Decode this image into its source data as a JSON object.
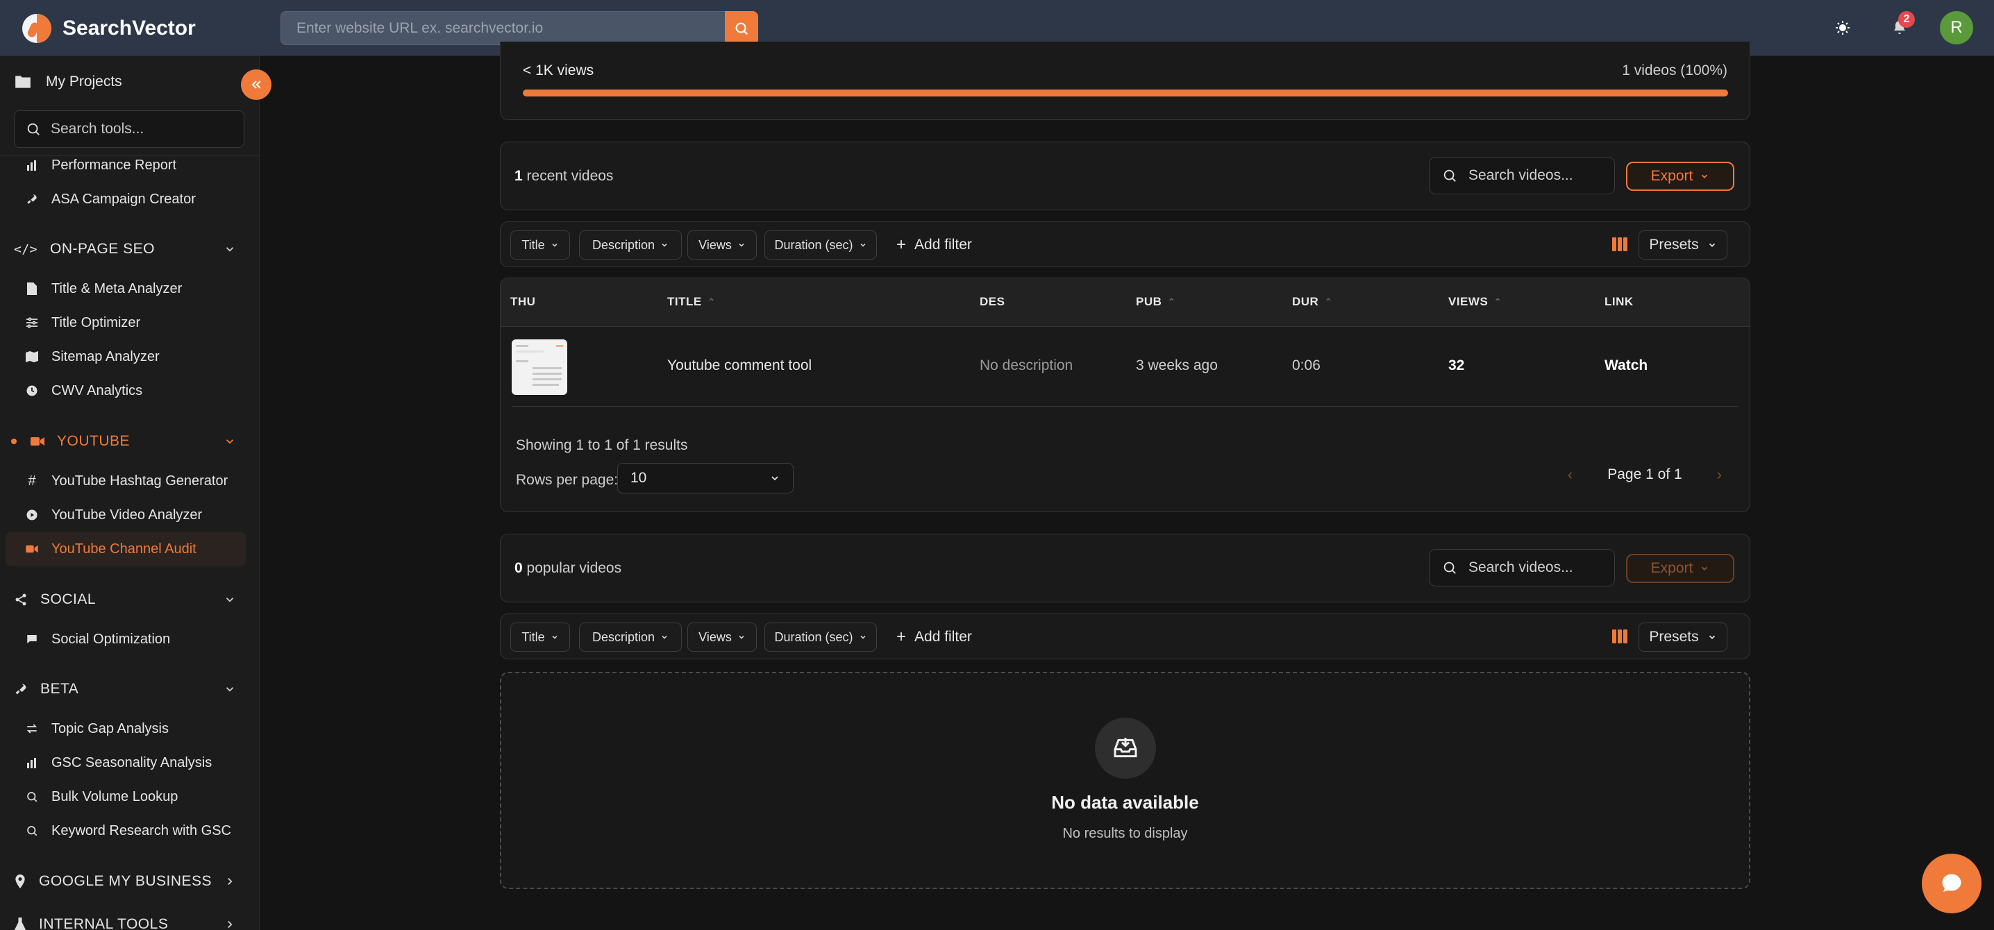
{
  "app": {
    "name": "SearchVector"
  },
  "topbar": {
    "url_placeholder": "Enter website URL ex. searchvector.io",
    "notification_count": "2",
    "avatar_initial": "R"
  },
  "sidebar": {
    "project_label": "My Projects",
    "search_placeholder": "Search tools...",
    "top_items": [
      {
        "label": "Performance Report",
        "icon": "bar-chart-icon"
      },
      {
        "label": "ASA Campaign Creator",
        "icon": "rocket-icon"
      }
    ],
    "sections": {
      "onpage": {
        "label": "ON-PAGE SEO",
        "items": [
          "Title & Meta Analyzer",
          "Title Optimizer",
          "Sitemap Analyzer",
          "CWV Analytics"
        ]
      },
      "youtube": {
        "label": "YOUTUBE",
        "items": [
          "YouTube Hashtag Generator",
          "YouTube Video Analyzer",
          "YouTube Channel Audit"
        ]
      },
      "social": {
        "label": "SOCIAL",
        "items": [
          "Social Optimization"
        ]
      },
      "beta": {
        "label": "BETA",
        "items": [
          "Topic Gap Analysis",
          "GSC Seasonality Analysis",
          "Bulk Volume Lookup",
          "Keyword Research with GSC"
        ]
      },
      "gmb": {
        "label": "GOOGLE MY BUSINESS"
      },
      "internal": {
        "label": "INTERNAL TOOLS"
      }
    }
  },
  "distribution": {
    "label": "< 1K views",
    "right": "1 videos (100%)",
    "percent": 100
  },
  "recent": {
    "count": "1",
    "title_suffix": " recent videos",
    "search_placeholder": "Search videos...",
    "export_label": "Export"
  },
  "filters": {
    "chips": [
      "Title",
      "Description",
      "Views",
      "Duration (sec)"
    ],
    "add_filter": "Add filter",
    "presets": "Presets"
  },
  "table": {
    "headers": [
      "THU",
      "TITLE",
      "DES",
      "PUB",
      "DUR",
      "VIEWS",
      "LINK"
    ],
    "rows": [
      {
        "title": "Youtube comment tool",
        "description": "No description",
        "published": "3 weeks ago",
        "duration": "0:06",
        "views": "32",
        "link": "Watch"
      }
    ],
    "showing": "Showing 1 to 1 of 1 results",
    "rows_per_page_label": "Rows per page:",
    "rows_per_page_value": "10",
    "page_label": "Page 1 of 1"
  },
  "popular": {
    "count": "0",
    "title_suffix": " popular videos",
    "search_placeholder": "Search videos...",
    "export_label": "Export"
  },
  "empty": {
    "title": "No data available",
    "subtitle": "No results to display"
  },
  "colors": {
    "accent": "#f07a3a",
    "topbar": "#2d3748",
    "background": "#141414"
  }
}
